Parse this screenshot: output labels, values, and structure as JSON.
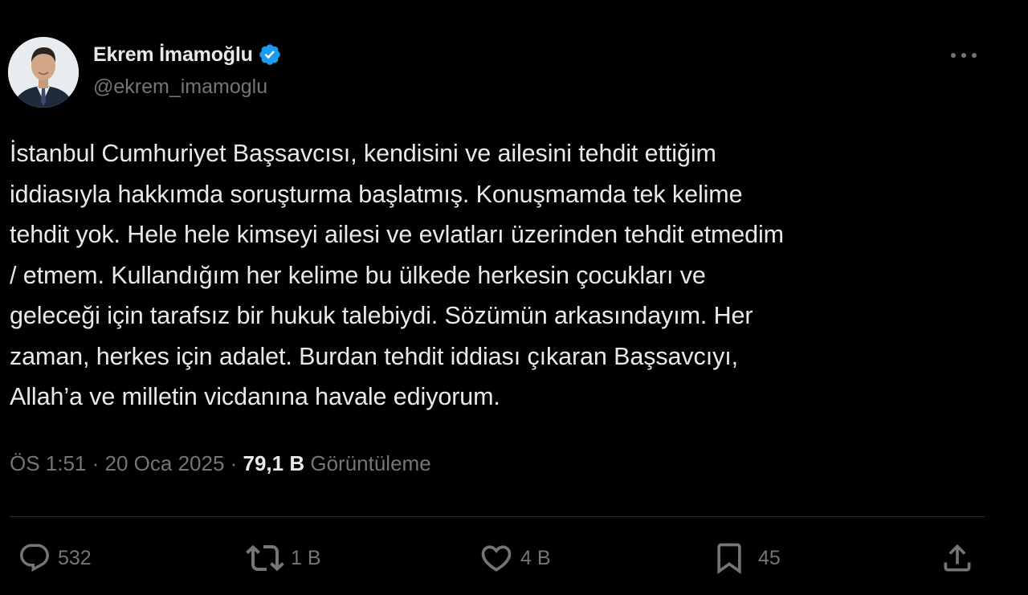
{
  "author": {
    "display_name": "Ekrem İmamoğlu",
    "handle": "@ekrem_imamoglu",
    "verified": true
  },
  "icons": {
    "verified": "verified-badge-icon",
    "more": "more-options-icon",
    "reply": "reply-icon",
    "retweet": "retweet-icon",
    "like": "like-icon",
    "bookmark": "bookmark-icon",
    "share": "share-icon"
  },
  "tweet": {
    "text": "İstanbul Cumhuriyet Başsavcısı, kendisini ve ailesini tehdit ettiğim\niddiasıyla hakkımda soruşturma başlatmış. Konuşmamda tek kelime\ntehdit yok. Hele hele kimseyi ailesi ve evlatları üzerinden tehdit etmedim\n/ etmem. Kullandığım her kelime bu ülkede herkesin çocukları ve\ngeleceği için tarafsız bir hukuk talebiydi. Sözümün arkasındayım. Her\nzaman, herkes için adalet. Burdan tehdit iddiası çıkaran Başsavcıyı,\nAllah’a ve milletin vicdanına havale ediyorum.",
    "time": "ÖS 1:51",
    "separator": " · ",
    "date": "20 Oca 2025",
    "views_count": "79,1 B",
    "views_label": "Görüntüleme"
  },
  "actions": {
    "replies": "532",
    "retweets": "1 B",
    "likes": "4 B",
    "bookmarks": "45"
  },
  "colors": {
    "background": "#000000",
    "text_primary": "#e7e9ea",
    "text_secondary": "#71767b",
    "verified_blue": "#1d9bf0",
    "divider": "#2f3336"
  }
}
